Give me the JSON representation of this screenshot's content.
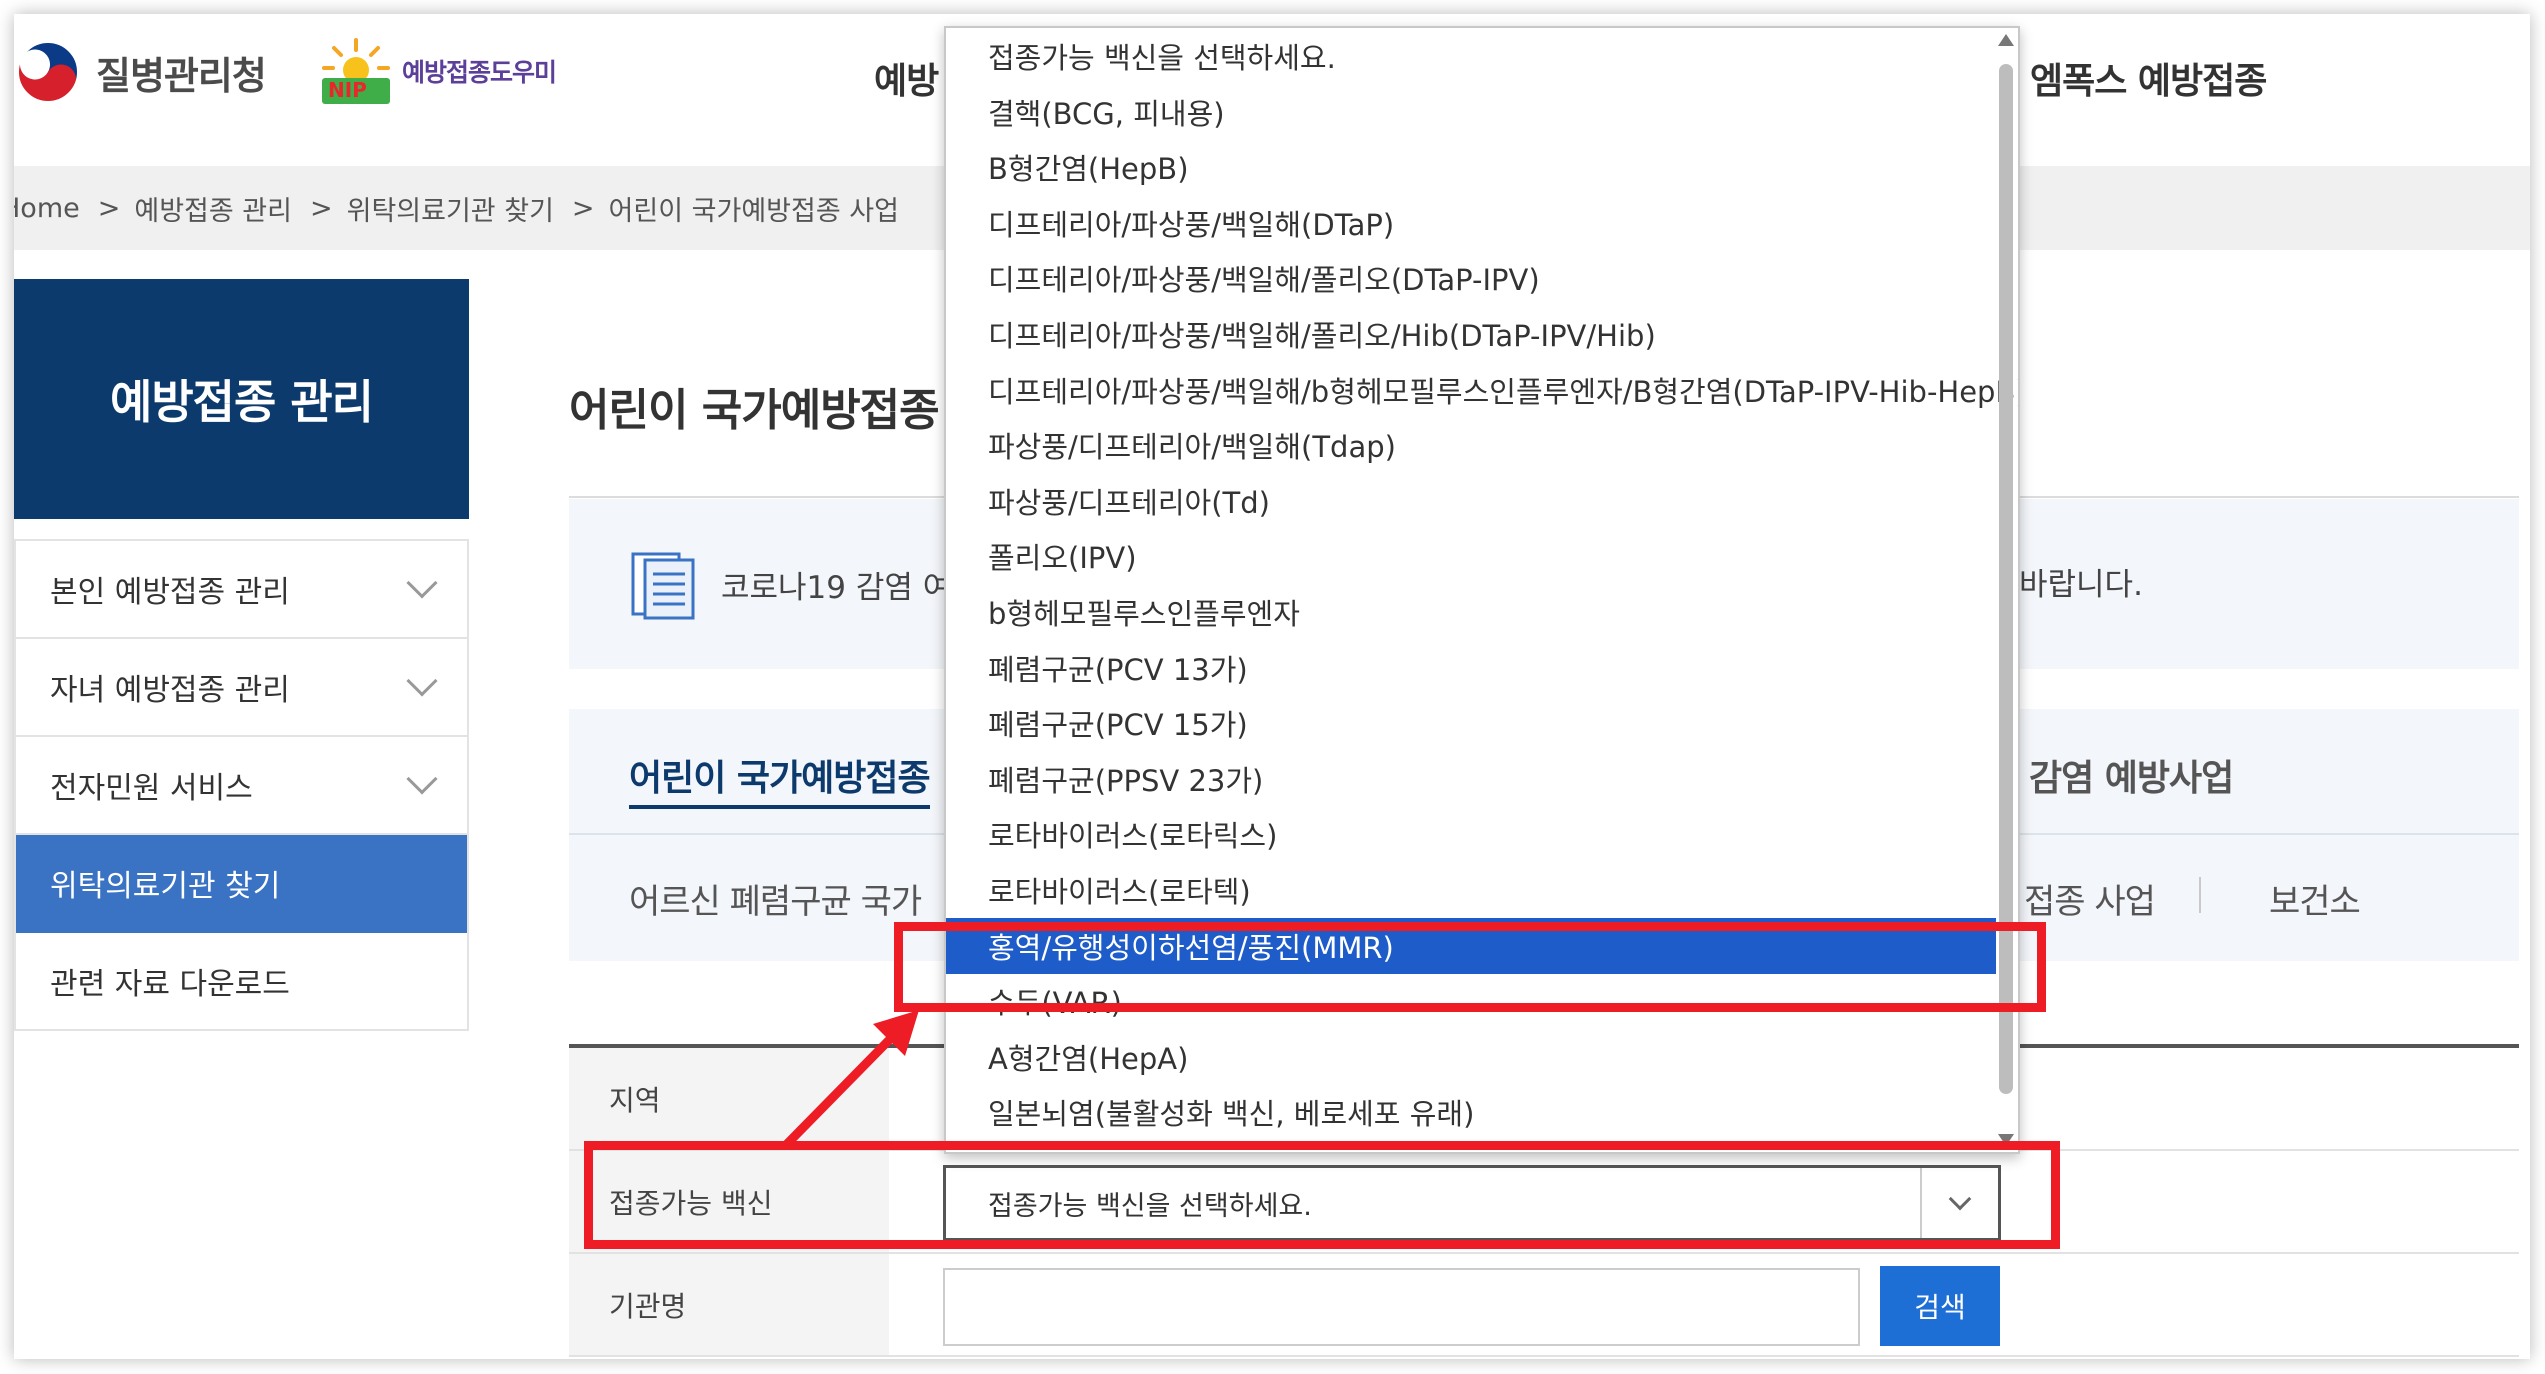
{
  "header": {
    "org_name": "질병관리청",
    "nip_label": "예방접종도우미",
    "nip_badge": "NIP",
    "nav_left": "예방",
    "nav_right": "엠폭스 예방접종"
  },
  "breadcrumb": [
    "Home",
    "예방접종 관리",
    "위탁의료기관 찾기",
    "어린이 국가예방접종 사업"
  ],
  "sidebar": {
    "title": "예방접종 관리",
    "items": [
      {
        "label": "본인 예방접종 관리",
        "active": false,
        "expandable": true
      },
      {
        "label": "자녀 예방접종 관리",
        "active": false,
        "expandable": true
      },
      {
        "label": "전자민원 서비스",
        "active": false,
        "expandable": true
      },
      {
        "label": "위탁의료기관 찾기",
        "active": true,
        "expandable": false
      },
      {
        "label": "관련 자료 다운로드",
        "active": false,
        "expandable": false
      }
    ]
  },
  "main": {
    "page_title": "어린이 국가예방접종",
    "notice_start": "코로나19 감염 여",
    "notice_end": "바랍니다.",
    "tabs": {
      "tab_a": "어린이 국가예방접종",
      "tab_b": "감염 예방사업",
      "tab_c": "어르신 폐렴구균 국가",
      "tab_d": "접종 사업",
      "tab_e": "보건소"
    }
  },
  "form": {
    "region_label": "지역",
    "vaccine_label": "접종가능 백신",
    "vaccine_selected": "접종가능 백신을 선택하세요.",
    "institution_label": "기관명",
    "institution_value": "",
    "search_button": "검색"
  },
  "dropdown": {
    "selected_index": 16,
    "options": [
      "접종가능 백신을 선택하세요.",
      "결핵(BCG, 피내용)",
      "B형간염(HepB)",
      "디프테리아/파상풍/백일해(DTaP)",
      "디프테리아/파상풍/백일해/폴리오(DTaP-IPV)",
      "디프테리아/파상풍/백일해/폴리오/Hib(DTaP-IPV/Hib)",
      "디프테리아/파상풍/백일해/b형헤모필루스인플루엔자/B형간염(DTaP-IPV-Hib-HepB)",
      "파상풍/디프테리아/백일해(Tdap)",
      "파상풍/디프테리아(Td)",
      "폴리오(IPV)",
      "b형헤모필루스인플루엔자",
      "폐렴구균(PCV 13가)",
      "폐렴구균(PCV 15가)",
      "폐렴구균(PPSV 23가)",
      "로타바이러스(로타릭스)",
      "로타바이러스(로타텍)",
      "홍역/유행성이하선염/풍진(MMR)",
      "수두(VAR)",
      "A형간염(HepA)",
      "일본뇌염(불활성화 백신, 베로세포 유래)"
    ]
  },
  "colors": {
    "sidebar_title_bg": "#0d3a6c",
    "sidebar_active_bg": "#3a73c4",
    "option_selected_bg": "#1e5cc9",
    "search_button_bg": "#1d6fd6",
    "annotation_red": "#ee1c24"
  }
}
